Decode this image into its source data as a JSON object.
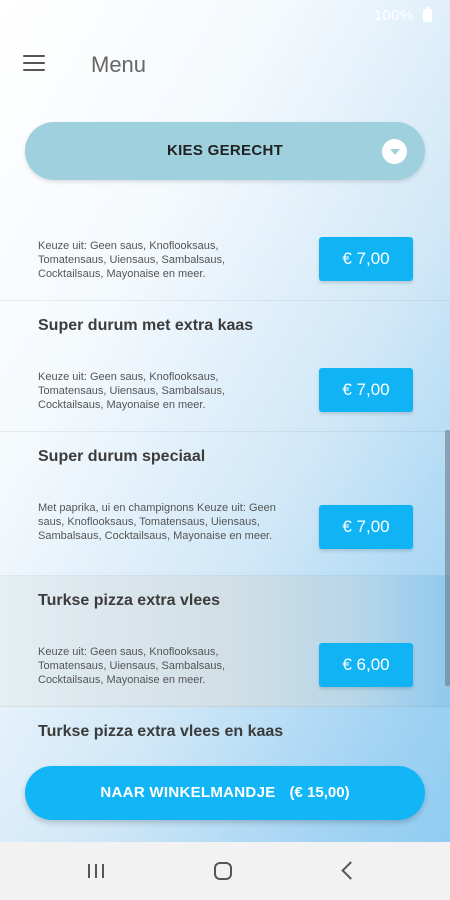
{
  "status_bar": {
    "text": "100%"
  },
  "app_bar": {
    "title": "Menu"
  },
  "dropdown": {
    "label": "KIES GERECHT"
  },
  "items": [
    {
      "title": "",
      "desc": "Keuze uit: Geen saus, Knoflooksaus, Tomatensaus, Uiensaus, Sambalsaus, Cocktailsaus, Mayonaise en meer.",
      "price": "€ 7,00"
    },
    {
      "title": "Super durum met extra kaas",
      "desc": "Keuze uit: Geen saus, Knoflooksaus, Tomatensaus, Uiensaus, Sambalsaus, Cocktailsaus, Mayonaise en meer.",
      "price": "€ 7,00"
    },
    {
      "title": "Super durum speciaal",
      "desc": "Met paprika, ui en champignons Keuze uit: Geen saus, Knoflooksaus, Tomatensaus, Uiensaus, Sambalsaus, Cocktailsaus, Mayonaise en meer.",
      "price": "€ 7,00"
    },
    {
      "title": "Turkse pizza extra vlees",
      "desc": "Keuze uit: Geen saus, Knoflooksaus, Tomatensaus, Uiensaus, Sambalsaus, Cocktailsaus, Mayonaise en meer.",
      "price": "€ 6,00"
    },
    {
      "title": "Turkse pizza extra vlees en kaas",
      "desc": "",
      "price": ""
    }
  ],
  "cart": {
    "label": "NAAR WINKELMANDJE",
    "total": "(€ 15,00)"
  },
  "colors": {
    "accent": "#12b6f6",
    "dropdown": "#9fd0de"
  },
  "icons": {
    "menu": "hamburger-icon",
    "chevron": "chevron-down-icon",
    "recent": "recent-apps-icon",
    "home": "home-icon",
    "back": "back-icon"
  }
}
